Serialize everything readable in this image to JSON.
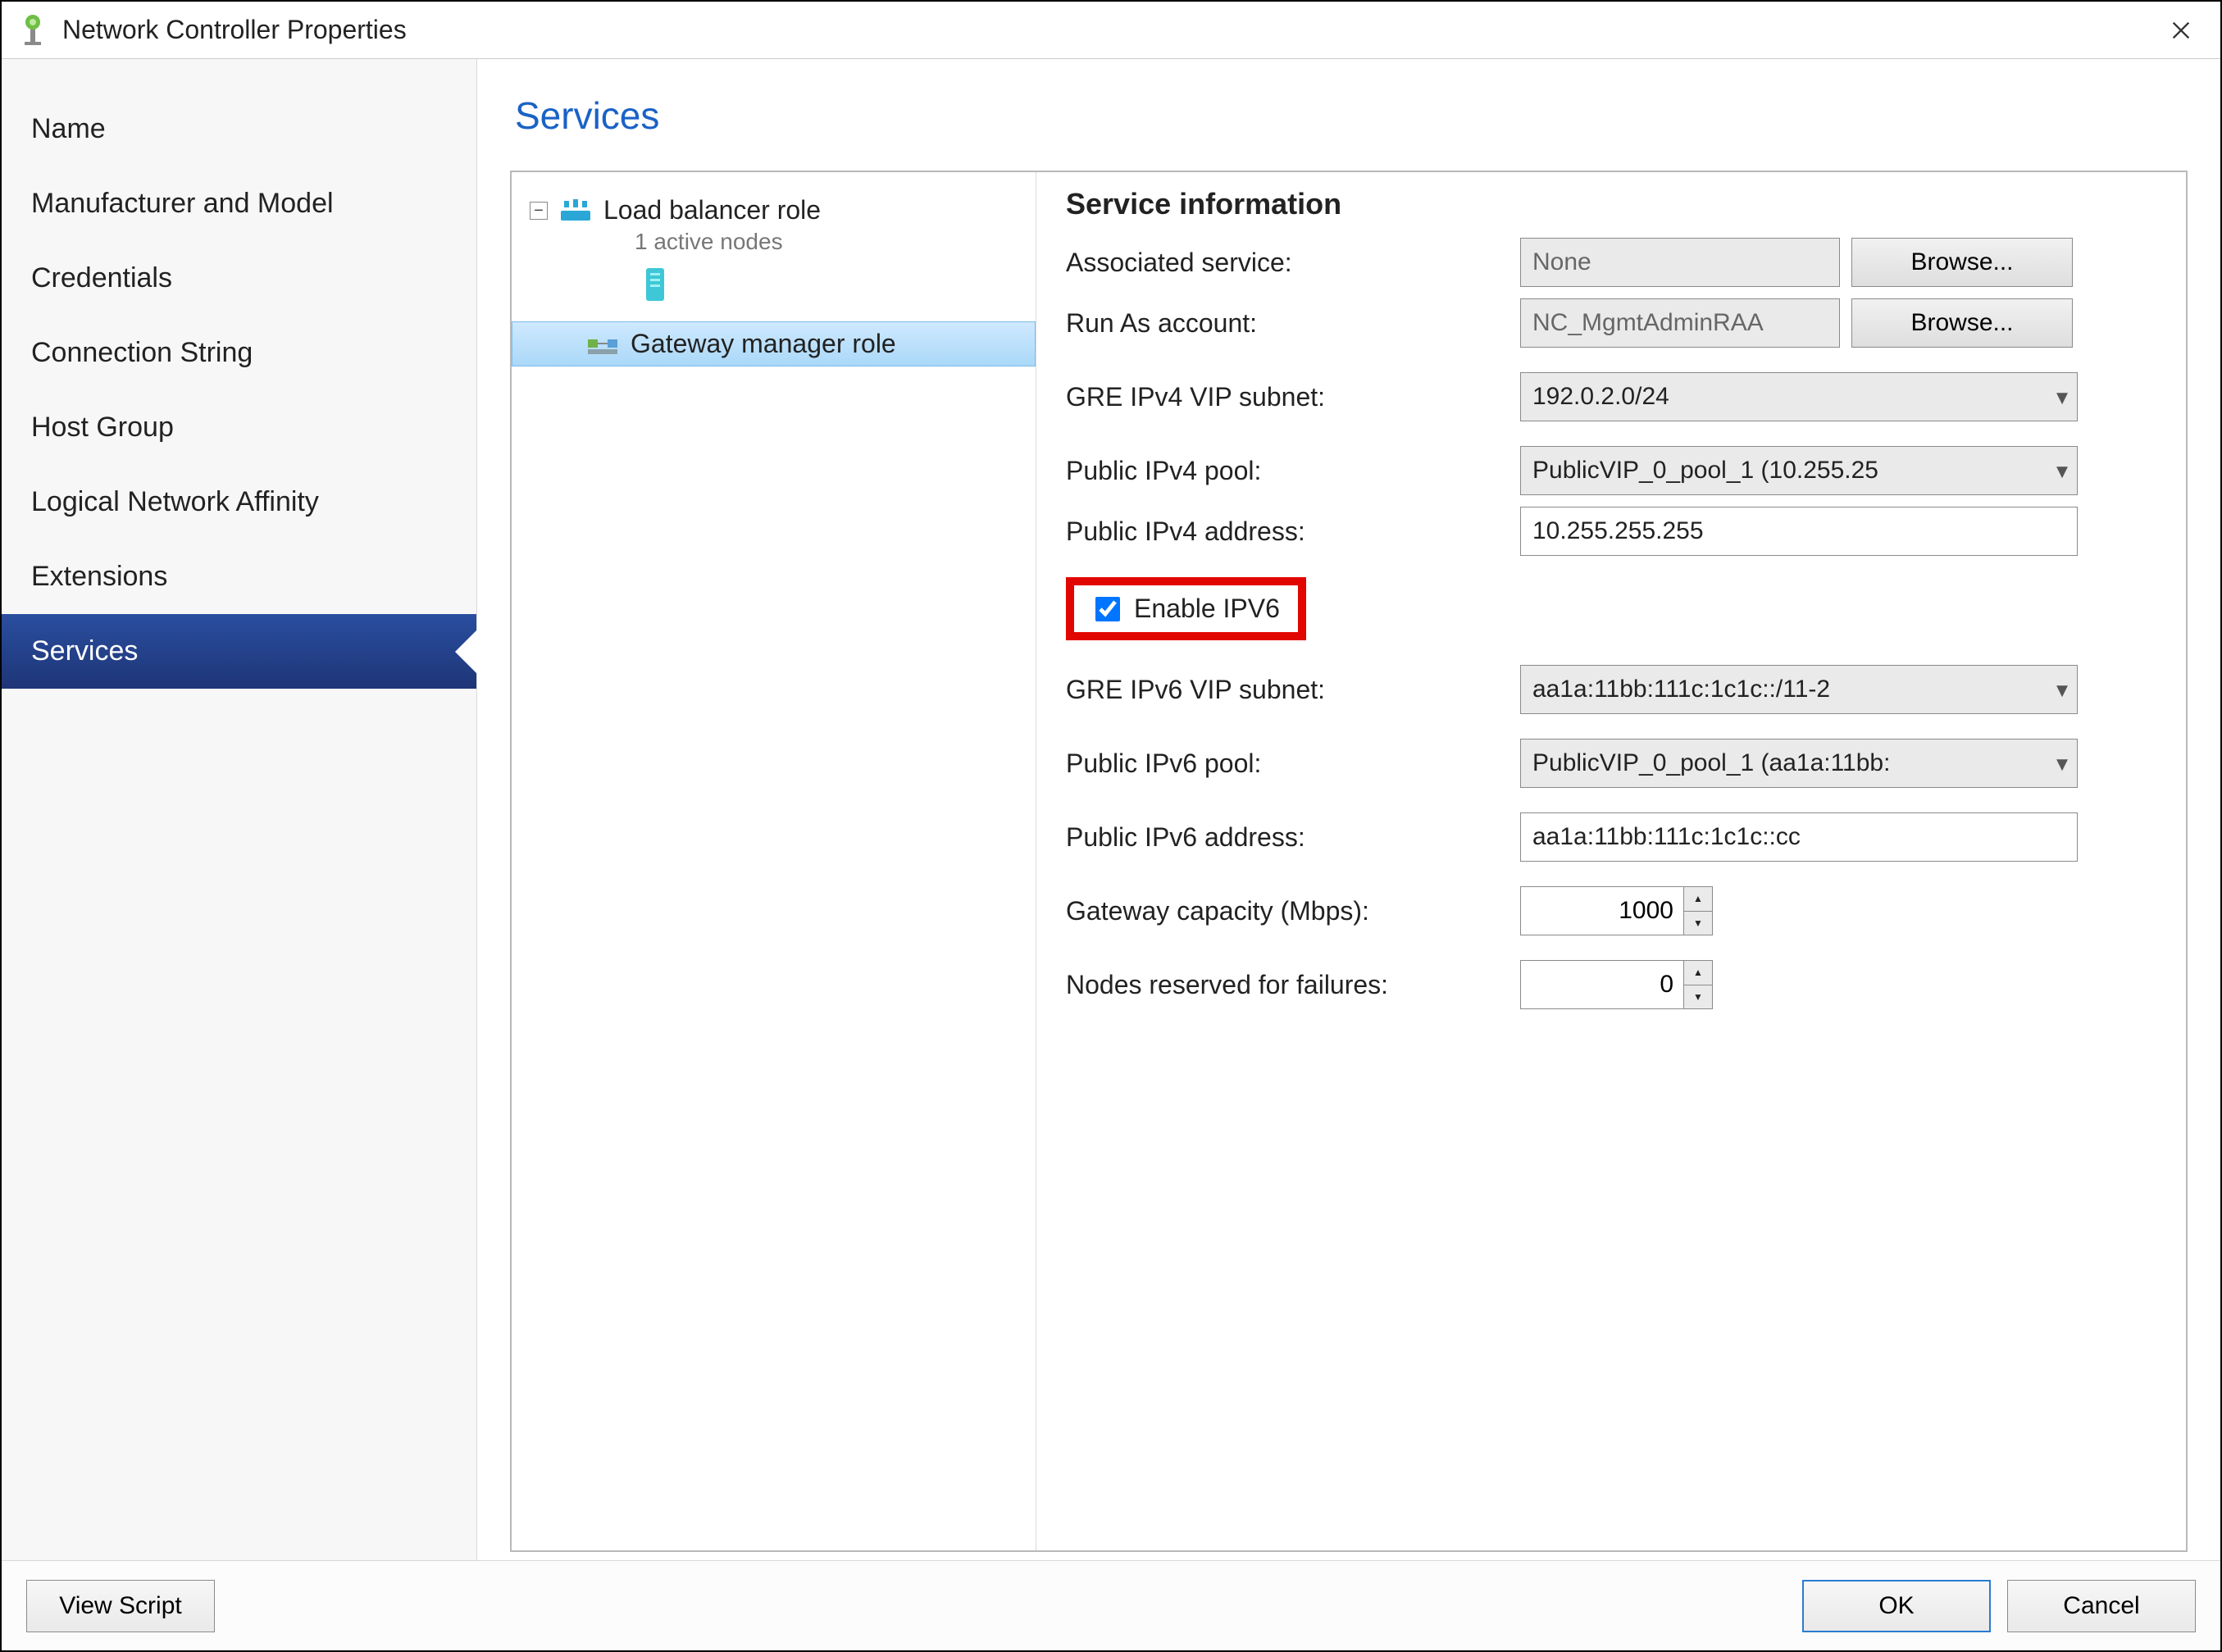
{
  "window": {
    "title": "Network Controller Properties"
  },
  "sidebar": {
    "items": [
      {
        "label": "Name"
      },
      {
        "label": "Manufacturer and Model"
      },
      {
        "label": "Credentials"
      },
      {
        "label": "Connection String"
      },
      {
        "label": "Host Group"
      },
      {
        "label": "Logical Network Affinity"
      },
      {
        "label": "Extensions"
      },
      {
        "label": "Services"
      }
    ],
    "selected_index": 7
  },
  "page_title": "Services",
  "tree": {
    "nodes": [
      {
        "label": "Load balancer role",
        "subtitle": "1 active nodes",
        "expanded": true
      },
      {
        "label": "Gateway manager role",
        "selected": true
      }
    ]
  },
  "form": {
    "section_head": "Service information",
    "associated_service": {
      "label": "Associated service:",
      "value": "None",
      "browse": "Browse..."
    },
    "run_as": {
      "label": "Run As account:",
      "value": "NC_MgmtAdminRAA",
      "browse": "Browse..."
    },
    "gre_v4": {
      "label": "GRE IPv4 VIP subnet:",
      "value": "192.0.2.0/24"
    },
    "pub_v4_pool": {
      "label": "Public IPv4 pool:",
      "value": "PublicVIP_0_pool_1 (10.255.25"
    },
    "pub_v4_addr": {
      "label": "Public IPv4 address:",
      "value": "10.255.255.255"
    },
    "enable_ipv6": {
      "label": "Enable IPV6",
      "checked": true
    },
    "gre_v6": {
      "label": "GRE IPv6 VIP subnet:",
      "value": "aa1a:11bb:111c:1c1c::/11-2"
    },
    "pub_v6_pool": {
      "label": "Public IPv6 pool:",
      "value": "PublicVIP_0_pool_1 (aa1a:11bb:"
    },
    "pub_v6_addr": {
      "label": "Public IPv6 address:",
      "value": "aa1a:11bb:111c:1c1c::cc"
    },
    "gateway_cap": {
      "label": "Gateway capacity (Mbps):",
      "value": "1000"
    },
    "nodes_reserved": {
      "label": "Nodes reserved for failures:",
      "value": "0"
    }
  },
  "buttons": {
    "view_script": "View Script",
    "ok": "OK",
    "cancel": "Cancel"
  }
}
